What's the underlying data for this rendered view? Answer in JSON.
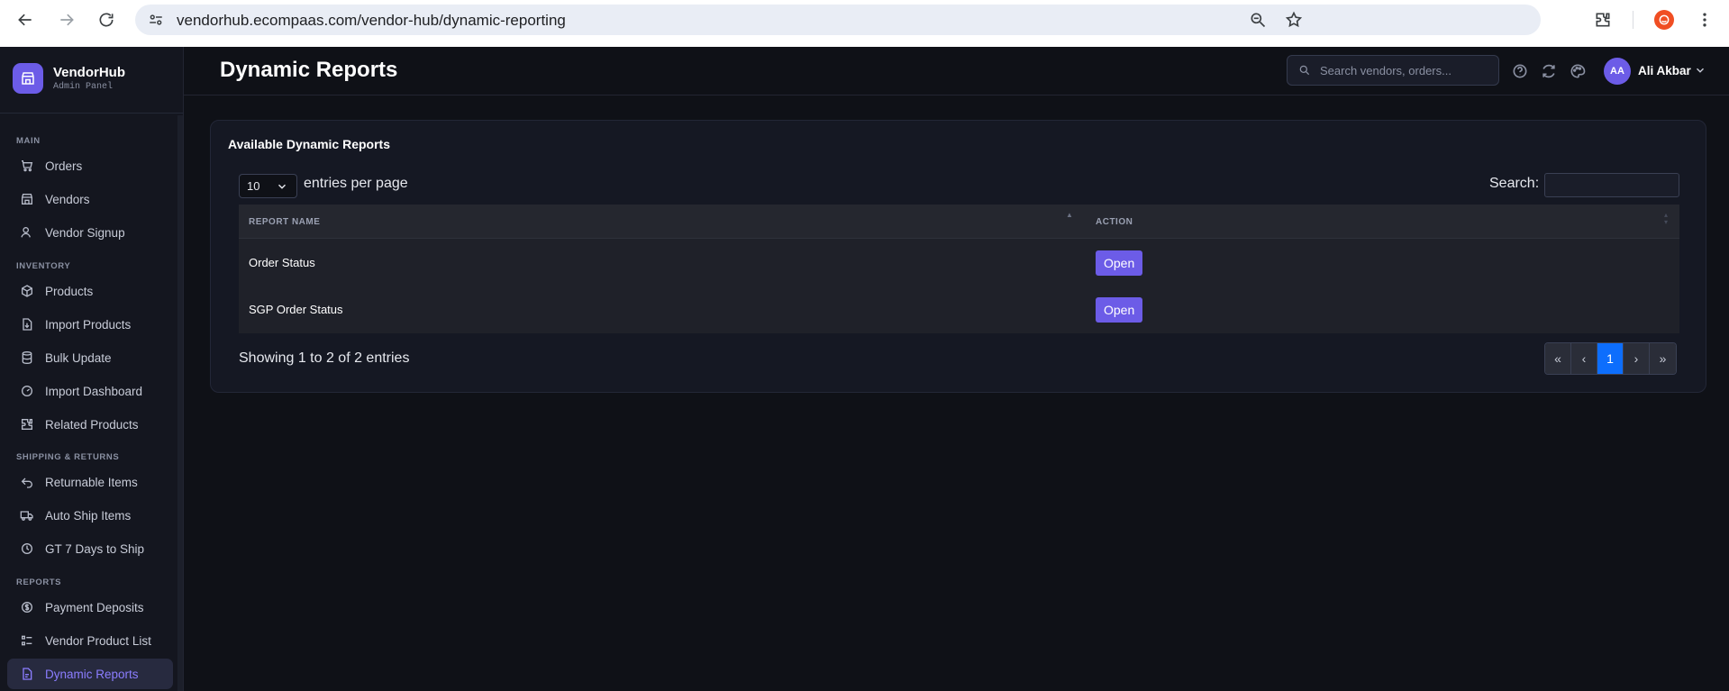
{
  "browser": {
    "url": "vendorhub.ecompaas.com/vendor-hub/dynamic-reporting"
  },
  "brand": {
    "name": "VendorHub",
    "subtitle": "Admin Panel"
  },
  "sidebar": {
    "sections": [
      {
        "label": "MAIN",
        "items": [
          {
            "label": "Orders",
            "icon": "cart-icon"
          },
          {
            "label": "Vendors",
            "icon": "store-icon"
          },
          {
            "label": "Vendor Signup",
            "icon": "user-plus-icon"
          }
        ]
      },
      {
        "label": "INVENTORY",
        "items": [
          {
            "label": "Products",
            "icon": "box-icon"
          },
          {
            "label": "Import Products",
            "icon": "file-import-icon"
          },
          {
            "label": "Bulk Update",
            "icon": "database-icon"
          },
          {
            "label": "Import Dashboard",
            "icon": "gauge-icon"
          },
          {
            "label": "Related Products",
            "icon": "puzzle-icon"
          }
        ]
      },
      {
        "label": "SHIPPING & RETURNS",
        "items": [
          {
            "label": "Returnable Items",
            "icon": "return-arrow-icon"
          },
          {
            "label": "Auto Ship Items",
            "icon": "truck-icon"
          },
          {
            "label": "GT 7 Days to Ship",
            "icon": "clock-icon"
          }
        ]
      },
      {
        "label": "REPORTS",
        "items": [
          {
            "label": "Payment Deposits",
            "icon": "dollar-circle-icon"
          },
          {
            "label": "Vendor Product List",
            "icon": "list-icon"
          },
          {
            "label": "Dynamic Reports",
            "icon": "report-icon",
            "active": true
          }
        ]
      }
    ]
  },
  "header": {
    "title": "Dynamic Reports",
    "search_placeholder": "Search vendors, orders...",
    "user_initials": "AA",
    "user_name": "Ali Akbar"
  },
  "card": {
    "title": "Available Dynamic Reports",
    "length_value": "10",
    "length_label": "entries per page",
    "search_label": "Search:",
    "columns": [
      "REPORT NAME",
      "ACTION"
    ],
    "rows": [
      {
        "name": "Order Status",
        "action": "Open"
      },
      {
        "name": "SGP Order Status",
        "action": "Open"
      }
    ],
    "info": "Showing 1 to 2 of 2 entries",
    "pager": [
      "«",
      "‹",
      "1",
      "›",
      "»"
    ],
    "current_page": "1"
  },
  "colors": {
    "accent": "#6c5ce7",
    "active_page": "#0d6efd",
    "background": "#0f1117"
  }
}
